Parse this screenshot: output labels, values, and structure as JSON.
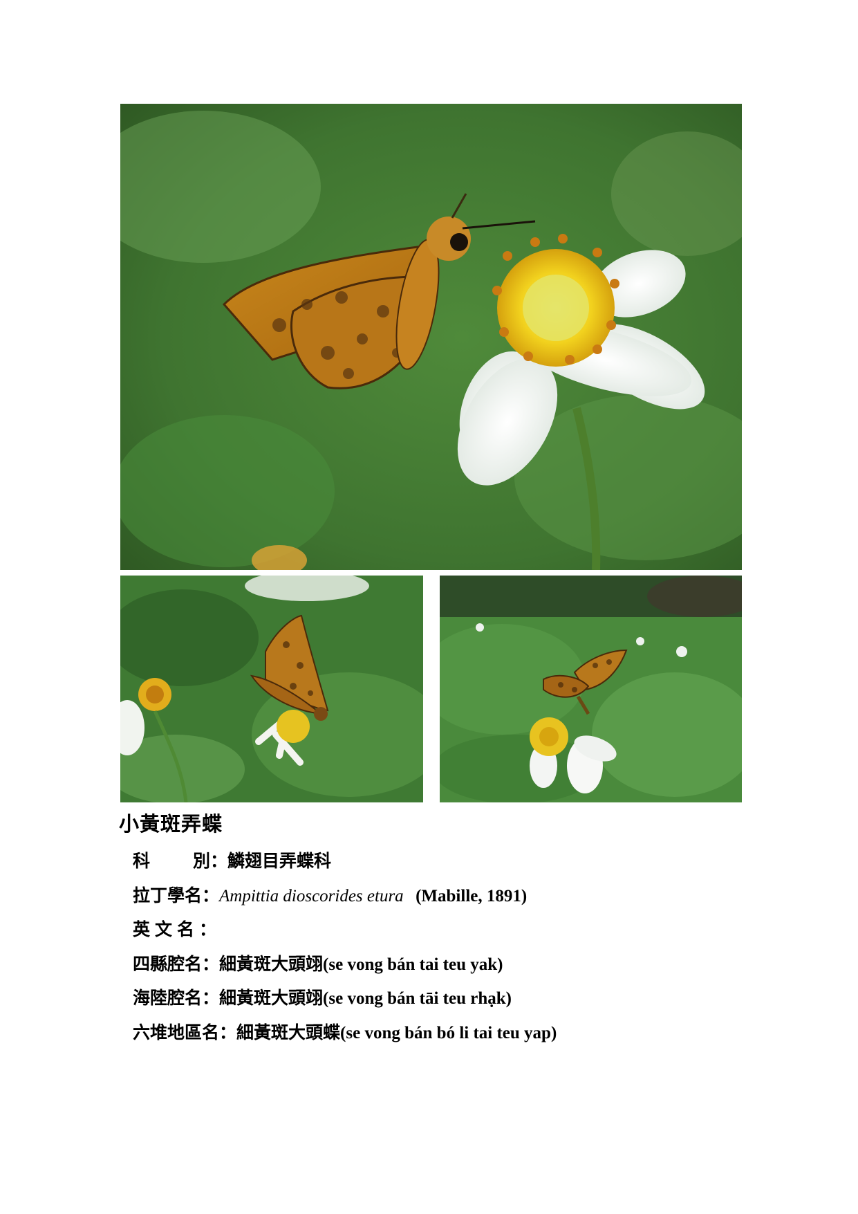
{
  "photos": {
    "main": {
      "subject": "skipper butterfly feeding on white daisy flower"
    },
    "left": {
      "subject": "skipper butterfly with wings raised on small daisy"
    },
    "right": {
      "subject": "skipper butterfly on yellow-centered flower among leaves"
    }
  },
  "title": "小黃斑弄蝶",
  "fields": {
    "family_label_a": "科",
    "family_label_b": "別",
    "family_value": "鱗翅目弄蝶科",
    "latin_label": "拉丁學名",
    "latin_value": "Ampittia dioscorides etura",
    "latin_author": "(Mabille, 1891)",
    "english_label": "英文名",
    "english_value": "",
    "sixian_label": "四縣腔名",
    "sixian_cn": "細黃斑大頭翊",
    "sixian_rom": "(se vong bán tai teu yak)",
    "hailu_label": "海陸腔名",
    "hailu_cn": "細黃斑大頭翊",
    "hailu_rom": "(se vong bán tāi teu rhạk)",
    "liudui_label": "六堆地區名",
    "liudui_cn": "細黃斑大頭蝶",
    "liudui_rom": "(se vong bán bó li tai teu yap)"
  },
  "separator": "："
}
